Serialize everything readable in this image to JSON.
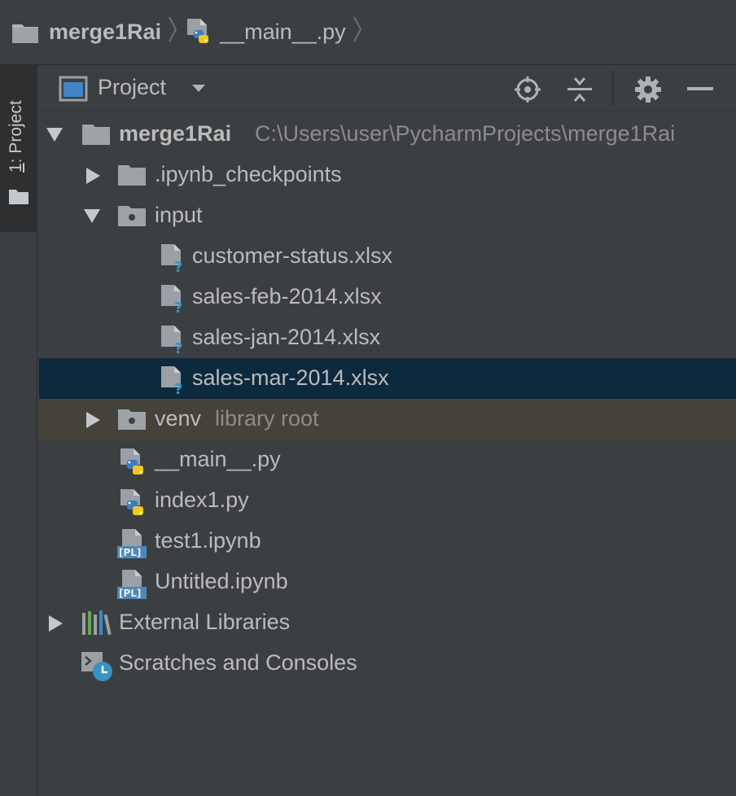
{
  "navbar": {
    "project": "merge1Rai",
    "file": "__main__.py"
  },
  "stripe": {
    "number": "1",
    "label": ": Project"
  },
  "panel": {
    "title": "Project"
  },
  "tree": {
    "root": {
      "label": "merge1Rai",
      "path": "C:\\Users\\user\\PycharmProjects\\merge1Rai"
    },
    "checkpoints": {
      "label": ".ipynb_checkpoints"
    },
    "input": {
      "label": "input"
    },
    "files": [
      {
        "label": "customer-status.xlsx"
      },
      {
        "label": "sales-feb-2014.xlsx"
      },
      {
        "label": "sales-jan-2014.xlsx"
      },
      {
        "label": "sales-mar-2014.xlsx"
      }
    ],
    "venv": {
      "label": "venv",
      "hint": "library root"
    },
    "main_py": {
      "label": "__main__.py"
    },
    "index_py": {
      "label": "index1.py"
    },
    "test_nb": {
      "label": "test1.ipynb"
    },
    "untitled_nb": {
      "label": "Untitled.ipynb"
    },
    "external": {
      "label": "External Libraries"
    },
    "scratches": {
      "label": "Scratches and Consoles"
    }
  },
  "colors": {
    "background": "#3c3f41",
    "selection": "#0d293e",
    "library_root": "#45423a",
    "text": "#bbbbbb",
    "hint": "#8c8c8c"
  },
  "icons": [
    "folder-icon",
    "python-file-icon",
    "project-view-icon",
    "dropdown-icon",
    "locate-icon",
    "collapse-all-icon",
    "gear-icon",
    "hide-icon",
    "expand-arrow-icon",
    "collapse-arrow-icon",
    "module-folder-icon",
    "unknown-file-icon",
    "notebook-file-icon",
    "library-icon",
    "scratches-icon"
  ]
}
